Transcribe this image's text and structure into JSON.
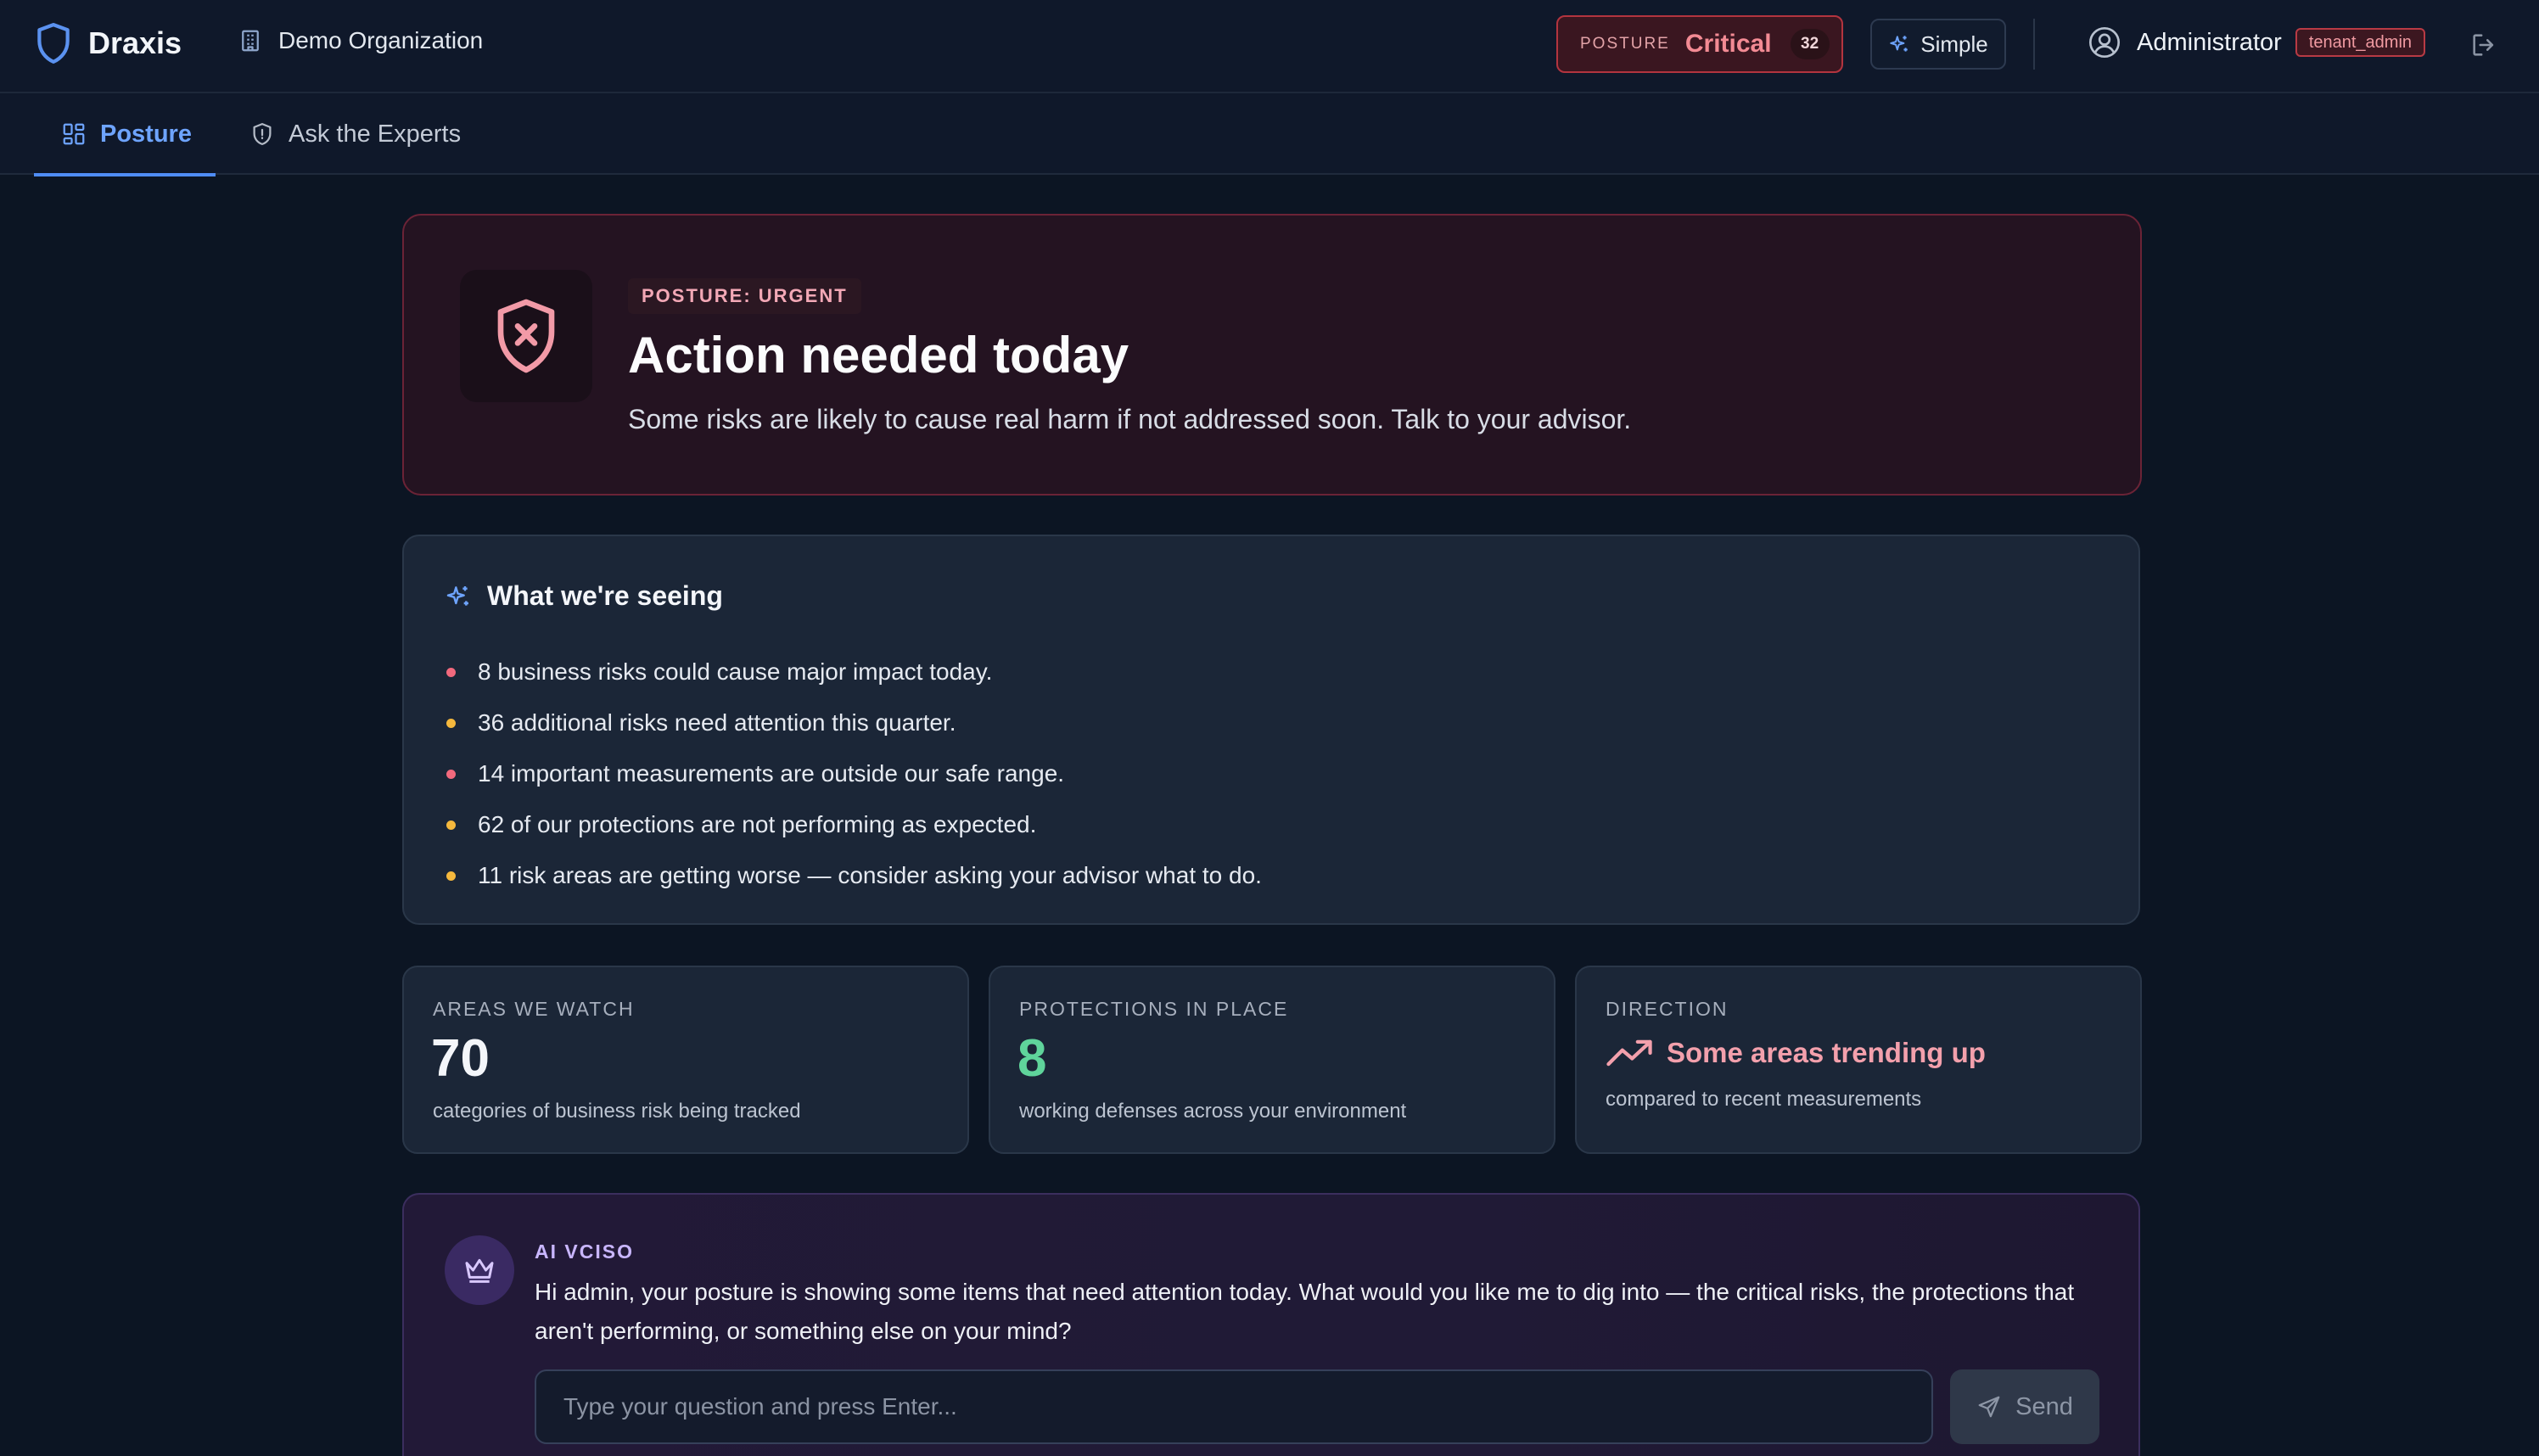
{
  "header": {
    "brand": "Draxis",
    "organization": "Demo Organization",
    "posture": {
      "label": "POSTURE",
      "value": "Critical",
      "count": "32"
    },
    "mode_label": "Simple",
    "user": {
      "name": "Administrator",
      "role": "tenant_admin"
    },
    "icons": [
      "shield-logo-icon",
      "building-icon",
      "sparkles-icon",
      "user-circle-icon",
      "logout-icon"
    ]
  },
  "tabs": [
    {
      "label": "Posture",
      "icon": "dashboard-icon",
      "active": true
    },
    {
      "label": "Ask the Experts",
      "icon": "shield-icon",
      "active": false
    }
  ],
  "hero": {
    "badge": "POSTURE: URGENT",
    "title": "Action needed today",
    "subtitle": "Some risks are likely to cause real harm if not addressed soon. Talk to your advisor.",
    "icon": "shield-x-icon"
  },
  "seeing": {
    "title": "What we're seeing",
    "items": [
      {
        "text": "8 business risks could cause major impact today.",
        "color": "#f2697d"
      },
      {
        "text": "36 additional risks need attention this quarter.",
        "color": "#f5b83d"
      },
      {
        "text": "14 important measurements are outside our safe range.",
        "color": "#f2697d"
      },
      {
        "text": "62 of our protections are not performing as expected.",
        "color": "#f5b83d"
      },
      {
        "text": "11 risk areas are getting worse — consider asking your advisor what to do.",
        "color": "#f5b83d"
      }
    ]
  },
  "stats": [
    {
      "label": "AREAS WE WATCH",
      "value": "70",
      "caption": "categories of business risk being tracked",
      "color": "#f4f6fa"
    },
    {
      "label": "PROTECTIONS IN PLACE",
      "value": "8",
      "caption": "working defenses across your environment",
      "color": "#5fd49b"
    },
    {
      "label": "DIRECTION",
      "value": "Some areas trending up",
      "caption": "compared to recent measurements",
      "color": "#f3a0ac",
      "icon": "trending-up-icon"
    }
  ],
  "ai": {
    "label": "AI VCISO",
    "message": "Hi admin, your posture is showing some items that need attention today. What would you like me to dig into — the critical risks, the protections that aren't performing, or something else on your mind?",
    "placeholder": "Type your question and press Enter...",
    "send_label": "Send",
    "icon": "crown-icon"
  },
  "colors": {
    "background": "#0c1523",
    "accent": "#4f8df6",
    "critical": "#f38b94",
    "success": "#5fd49b"
  }
}
